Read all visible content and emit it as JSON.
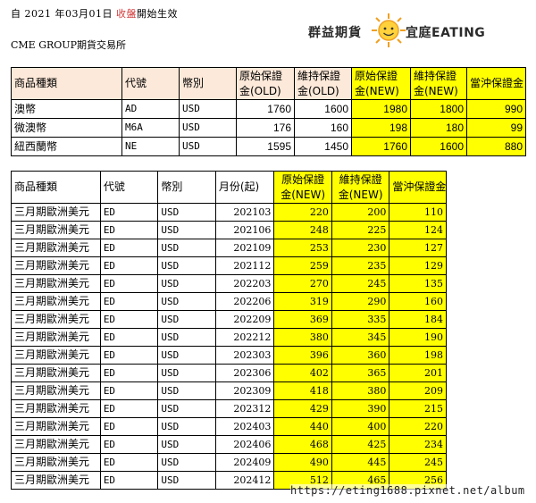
{
  "notice": {
    "prefix": "自 2021 年03月01日",
    "highlight": "收盤",
    "suffix": "開始生效"
  },
  "exchange": "CME GROUP期貨交易所",
  "logo": {
    "part1": "群益期貨",
    "part2": "宜庭EATING"
  },
  "table1": {
    "headers": [
      [
        "商品種類",
        ""
      ],
      [
        "代號",
        ""
      ],
      [
        "幣別",
        ""
      ],
      [
        "原始保證",
        "金(OLD)"
      ],
      [
        "維持保證",
        "金(OLD)"
      ],
      [
        "原始保證",
        "金(NEW)"
      ],
      [
        "維持保證",
        "金(NEW)"
      ],
      [
        "當沖保證金",
        ""
      ]
    ],
    "rows": [
      [
        "澳幣",
        "AD",
        "USD",
        "1760",
        "1600",
        "1980",
        "1800",
        "990"
      ],
      [
        "微澳幣",
        "M6A",
        "USD",
        "176",
        "160",
        "198",
        "180",
        "99"
      ],
      [
        "紐西蘭幣",
        "NE",
        "USD",
        "1595",
        "1450",
        "1760",
        "1600",
        "880"
      ]
    ]
  },
  "table2": {
    "headers": [
      [
        "商品種類",
        ""
      ],
      [
        "代號",
        ""
      ],
      [
        "幣別",
        ""
      ],
      [
        "月份(起)",
        ""
      ],
      [
        "原始保證",
        "金(NEW)"
      ],
      [
        "維持保證",
        "金(NEW)"
      ],
      [
        "當沖保證金",
        ""
      ]
    ],
    "rows": [
      [
        "三月期歐洲美元",
        "ED",
        "USD",
        "202103",
        "220",
        "200",
        "110"
      ],
      [
        "三月期歐洲美元",
        "ED",
        "USD",
        "202106",
        "248",
        "225",
        "124"
      ],
      [
        "三月期歐洲美元",
        "ED",
        "USD",
        "202109",
        "253",
        "230",
        "127"
      ],
      [
        "三月期歐洲美元",
        "ED",
        "USD",
        "202112",
        "259",
        "235",
        "129"
      ],
      [
        "三月期歐洲美元",
        "ED",
        "USD",
        "202203",
        "270",
        "245",
        "135"
      ],
      [
        "三月期歐洲美元",
        "ED",
        "USD",
        "202206",
        "319",
        "290",
        "160"
      ],
      [
        "三月期歐洲美元",
        "ED",
        "USD",
        "202209",
        "369",
        "335",
        "184"
      ],
      [
        "三月期歐洲美元",
        "ED",
        "USD",
        "202212",
        "380",
        "345",
        "190"
      ],
      [
        "三月期歐洲美元",
        "ED",
        "USD",
        "202303",
        "396",
        "360",
        "198"
      ],
      [
        "三月期歐洲美元",
        "ED",
        "USD",
        "202306",
        "402",
        "365",
        "201"
      ],
      [
        "三月期歐洲美元",
        "ED",
        "USD",
        "202309",
        "418",
        "380",
        "209"
      ],
      [
        "三月期歐洲美元",
        "ED",
        "USD",
        "202312",
        "429",
        "390",
        "215"
      ],
      [
        "三月期歐洲美元",
        "ED",
        "USD",
        "202403",
        "440",
        "400",
        "220"
      ],
      [
        "三月期歐洲美元",
        "ED",
        "USD",
        "202406",
        "468",
        "425",
        "234"
      ],
      [
        "三月期歐洲美元",
        "ED",
        "USD",
        "202409",
        "490",
        "445",
        "245"
      ],
      [
        "三月期歐洲美元",
        "ED",
        "USD",
        "202412",
        "512",
        "465",
        "256"
      ]
    ]
  },
  "watermark": "https://eting1688.pixnet.net/album",
  "colors": {
    "header_bg": "#fde9d9",
    "highlight_bg": "#ffff00",
    "notice_red": "#d23c3c"
  }
}
